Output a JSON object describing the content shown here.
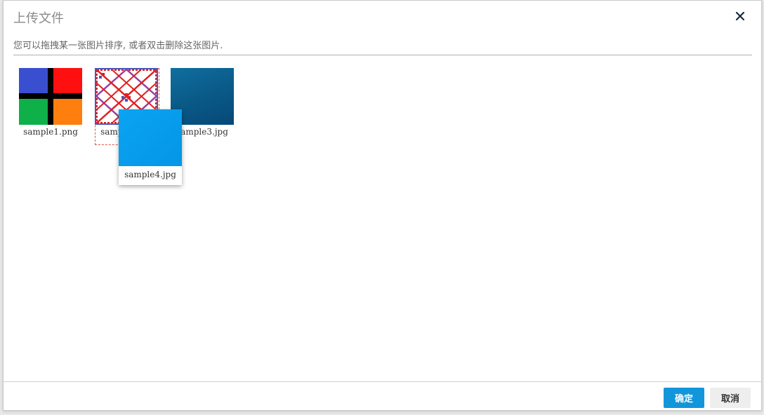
{
  "dialog": {
    "title": "上传文件",
    "instruction": "您可以拖拽某一张图片排序, 或者双击删除这张图片.",
    "close_icon": "close-icon"
  },
  "images": [
    {
      "caption": "sample1.png",
      "preview": "four-color-grid"
    },
    {
      "caption": "sample2.jpg",
      "preview": "red-diamond-lattice"
    },
    {
      "caption": "sample3.jpg",
      "preview": "dark-blue-gradient"
    }
  ],
  "dragging": {
    "caption": "sample4.jpg",
    "preview": "light-blue-gradient"
  },
  "footer": {
    "confirm_label": "确定",
    "cancel_label": "取消"
  },
  "colors": {
    "accent": "#1296db",
    "cancel_bg": "#eeeeee",
    "placeholder_border": "#d9534f"
  }
}
